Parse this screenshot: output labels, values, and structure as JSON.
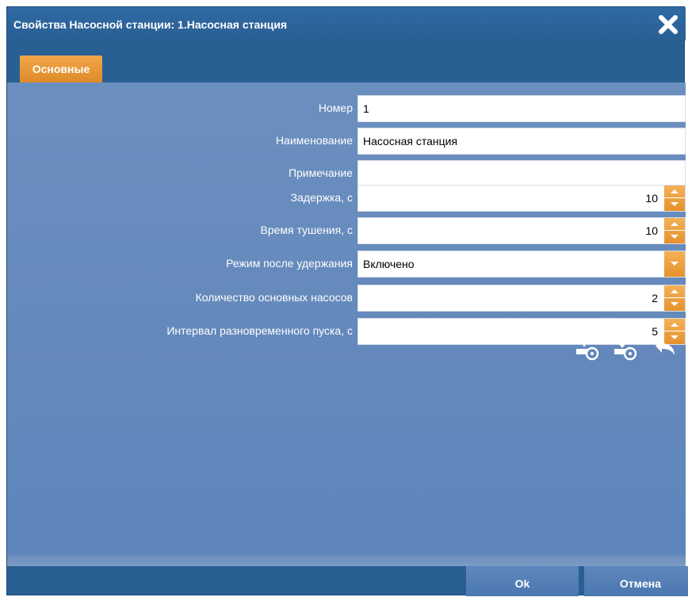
{
  "dialog": {
    "title": "Свойства Насосной станции: 1.Насосная станция",
    "tab": "Основные"
  },
  "fields": {
    "number": {
      "label": "Номер",
      "value": "1"
    },
    "name": {
      "label": "Наименование",
      "value": "Насосная станция"
    },
    "note": {
      "label": "Примечание",
      "value": ""
    },
    "delay": {
      "label": "Задержка, с",
      "value": "10"
    },
    "extinguish_time": {
      "label": "Время тушения, с",
      "value": "10"
    },
    "after_hold_mode": {
      "label": "Режим после удержания",
      "value": "Включено"
    },
    "main_pumps_count": {
      "label": "Количество основных насосов",
      "value": "2"
    },
    "staggered_start_interval": {
      "label": "Интервал разновременного пуска, с",
      "value": "5"
    }
  },
  "toolbar": {
    "icons": [
      "upload-disk-icon",
      "download-disk-icon",
      "undo-icon"
    ]
  },
  "footer": {
    "ok_label": "Ok",
    "cancel_label": "Отмена"
  },
  "colors": {
    "accent": "#e6922d",
    "title_bar": "#2a5f94",
    "panel": "#6388bc"
  }
}
